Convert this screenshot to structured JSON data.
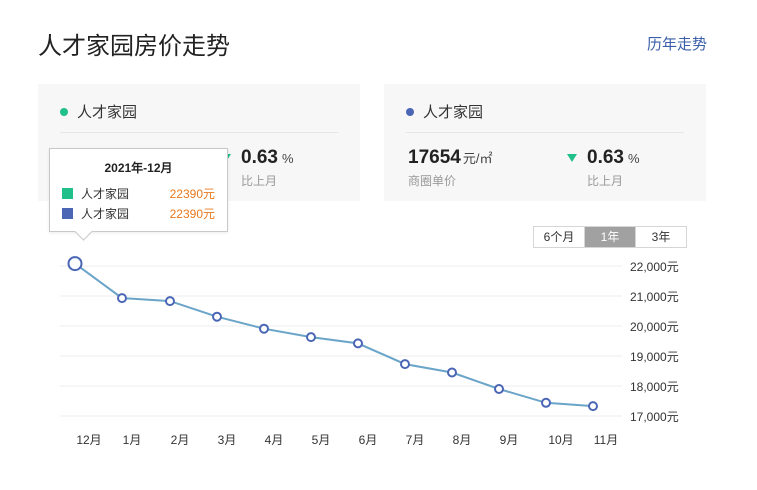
{
  "header": {
    "title": "人才家园房价走势",
    "history_link": "历年走势"
  },
  "cards": [
    {
      "name": "人才家园",
      "color": "#21bf8a",
      "price": "",
      "price_unit": "",
      "price_label": "",
      "change": "0.63",
      "change_unit": "%",
      "change_label": "比上月"
    },
    {
      "name": "人才家园",
      "color": "#4a66b5",
      "price": "17654",
      "price_unit": "元/㎡",
      "price_label": "商圈单价",
      "change": "0.63",
      "change_unit": "%",
      "change_label": "比上月"
    }
  ],
  "range_tabs": [
    {
      "label": "6个月",
      "active": false
    },
    {
      "label": "1年",
      "active": true
    },
    {
      "label": "3年",
      "active": false
    }
  ],
  "tooltip": {
    "title": "2021年-12月",
    "rows": [
      {
        "name": "人才家园",
        "value": "22390元",
        "color": "#21bf8a"
      },
      {
        "name": "人才家园",
        "value": "22390元",
        "color": "#4a66b5"
      }
    ]
  },
  "chart_data": {
    "type": "line",
    "categories": [
      "12月",
      "1月",
      "2月",
      "3月",
      "4月",
      "5月",
      "6月",
      "7月",
      "8月",
      "9月",
      "10月",
      "11月"
    ],
    "series": [
      {
        "name": "人才家园",
        "color": "#6aa4c8",
        "marker_color": "#4a66b5",
        "values": [
          22080,
          20930,
          20830,
          20310,
          19910,
          19630,
          19420,
          18730,
          18450,
          17900,
          17440,
          17330
        ]
      }
    ],
    "highlight_index": 0,
    "yticks": [
      17000,
      18000,
      19000,
      20000,
      21000,
      22000
    ],
    "ytick_labels": [
      "17,000元",
      "18,000元",
      "19,000元",
      "20,000元",
      "21,000元",
      "22,000元"
    ],
    "ylim": [
      17000,
      22000
    ],
    "grid": true
  }
}
